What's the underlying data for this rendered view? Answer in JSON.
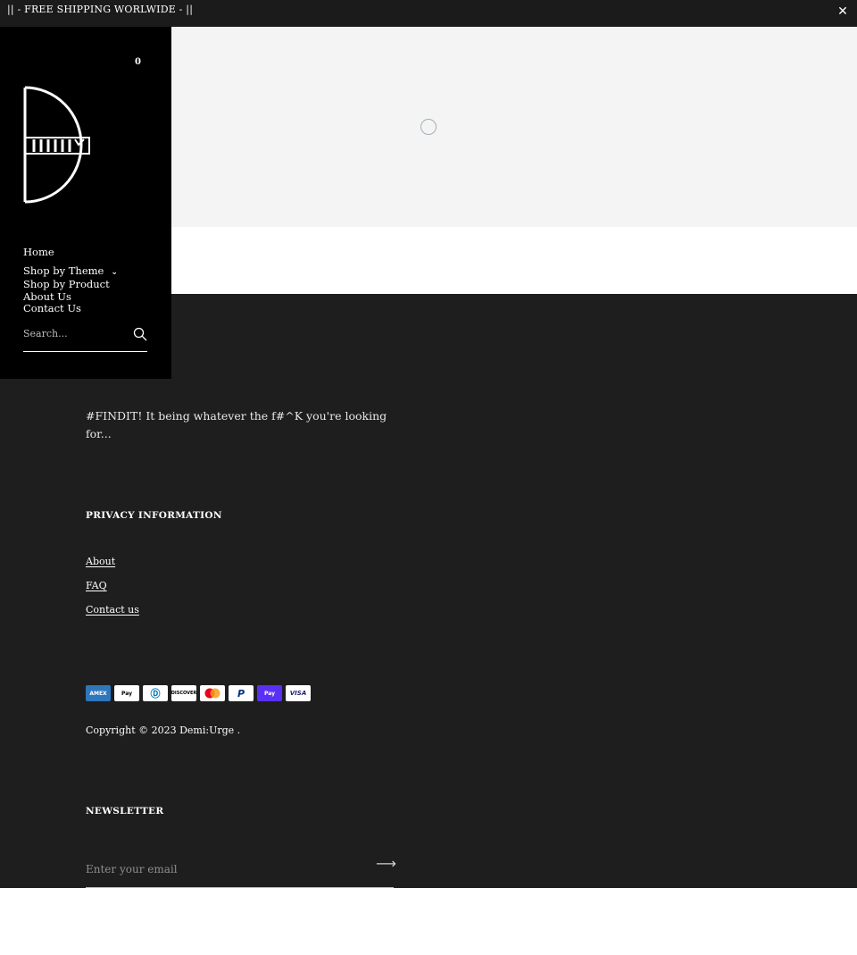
{
  "announcement": {
    "text": "|| - FREE SHIPPING WORLWIDE - ||",
    "close_icon": "close-icon"
  },
  "header": {
    "cart_count": "0",
    "logo_icon": "demiurge-logo"
  },
  "nav": {
    "items": [
      {
        "label": "Home"
      },
      {
        "label": "Shop by Theme",
        "has_dropdown": true
      },
      {
        "label": "Shop by Product"
      },
      {
        "label": "About Us"
      },
      {
        "label": "Contact Us"
      }
    ]
  },
  "search": {
    "placeholder": "Search...",
    "icon": "search-icon"
  },
  "footer": {
    "tagline": "#FINDIT! It being whatever the f#^K you're looking for...",
    "privacy_heading": "PRIVACY INFORMATION",
    "links": [
      "About",
      "FAQ",
      "Contact us"
    ],
    "payment_methods": [
      "American Express",
      "Apple Pay",
      "Diners Club",
      "Discover",
      "Mastercard",
      "PayPal",
      "Shop Pay",
      "Visa"
    ],
    "copyright": "Copyright © 2023 Demi:Urge .",
    "newsletter_heading": "NEWSLETTER",
    "newsletter_placeholder": "Enter your email"
  },
  "colors": {
    "announcement_bg": "#1b1b1b",
    "sidebar_bg": "#000000",
    "footer_bg": "#1e1e1e",
    "hero_bg": "#f4f4f4"
  }
}
